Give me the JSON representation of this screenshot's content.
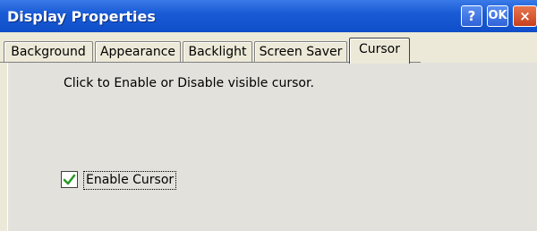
{
  "window": {
    "title": "Display Properties",
    "help_label": "?",
    "ok_label": "OK",
    "close_label": "×"
  },
  "tabs": [
    {
      "label": "Background",
      "active": false
    },
    {
      "label": "Appearance",
      "active": false
    },
    {
      "label": "Backlight",
      "active": false
    },
    {
      "label": "Screen Saver",
      "active": false
    },
    {
      "label": "Cursor",
      "active": true
    }
  ],
  "cursor_page": {
    "instruction": "Click to Enable or Disable visible cursor.",
    "enable_cursor": {
      "label": "Enable Cursor",
      "checked": true
    }
  },
  "colors": {
    "title_bar": "#1a5cd6",
    "panel_bg": "#e3e1dc",
    "check_mark": "#2a9a2a"
  }
}
